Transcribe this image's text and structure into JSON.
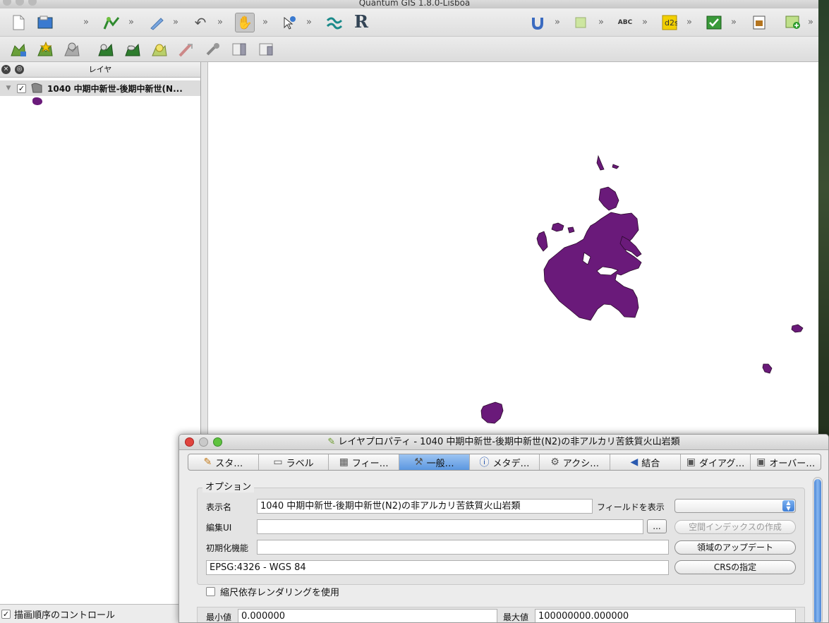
{
  "app": {
    "title": "Quantum GIS 1.8.0-Lisboa"
  },
  "layers_panel": {
    "title": "レイヤ",
    "layer_name": "1040  中期中新世-後期中新世(N...",
    "draw_order_label": "描画順序のコントロール"
  },
  "colors": {
    "polygon_fill": "#6a1a7a",
    "polygon_stroke": "#2a0a2a",
    "active_tab": "#5b97e0"
  },
  "dialog": {
    "title": "レイヤプロパティ - 1040  中期中新世-後期中新世(N2)の非アルカリ苦鉄質火山岩類",
    "tabs": [
      {
        "label": "スタ…",
        "icon": "brush-icon"
      },
      {
        "label": "ラベル",
        "icon": "label-icon"
      },
      {
        "label": "フィー…",
        "icon": "table-icon"
      },
      {
        "label": "一般…",
        "icon": "tools-icon"
      },
      {
        "label": "メタデ…",
        "icon": "info-icon"
      },
      {
        "label": "アクシ…",
        "icon": "gear-icon"
      },
      {
        "label": "結合",
        "icon": "join-icon"
      },
      {
        "label": "ダイアグ…",
        "icon": "diagram-icon"
      },
      {
        "label": "オーバー…",
        "icon": "overlay-icon"
      }
    ],
    "options": {
      "group_title": "オプション",
      "display_name_label": "表示名",
      "display_name_value": "1040  中期中新世-後期中新世(N2)の非アルカリ苦鉄質火山岩類",
      "display_field_label": "フィールドを表示",
      "edit_ui_label": "編集UI",
      "edit_ui_value": "",
      "browse_label": "...",
      "spatial_index_label": "空間インデックスの作成",
      "init_func_label": "初期化機能",
      "init_func_value": "",
      "update_extent_label": "領域のアップデート",
      "crs_value": "EPSG:4326 - WGS 84",
      "set_crs_label": "CRSの指定"
    },
    "scale_dependent_label": "縮尺依存レンダリングを使用",
    "min_label": "最小値",
    "min_value": "0.000000",
    "max_label": "最大値",
    "max_value": "100000000.000000"
  }
}
